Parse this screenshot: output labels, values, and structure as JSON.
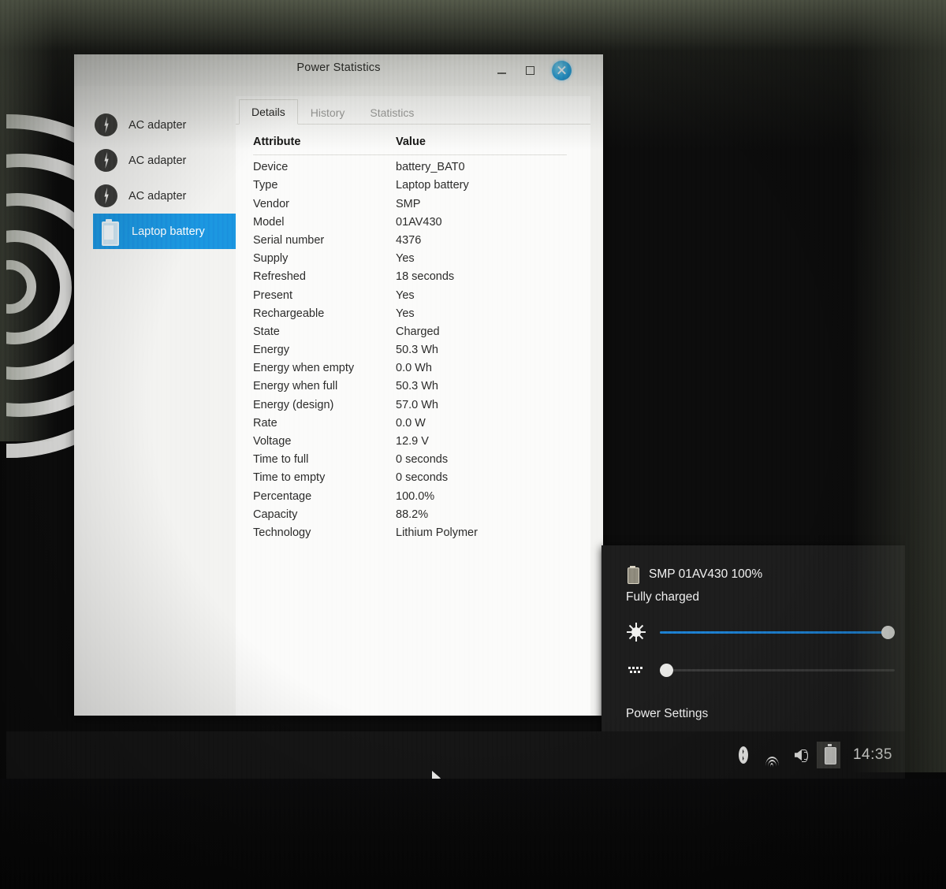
{
  "window": {
    "title": "Power Statistics",
    "controls": {
      "minimize": "minimize-button",
      "maximize": "maximize-button",
      "close": "close-button"
    }
  },
  "sidebar": {
    "devices": [
      {
        "label": "AC adapter",
        "icon": "ac-adapter-icon",
        "selected": false
      },
      {
        "label": "AC adapter",
        "icon": "ac-adapter-icon",
        "selected": false
      },
      {
        "label": "AC adapter",
        "icon": "ac-adapter-icon",
        "selected": false
      },
      {
        "label": "Laptop battery",
        "icon": "battery-icon",
        "selected": true
      }
    ]
  },
  "tabs": [
    {
      "label": "Details",
      "active": true
    },
    {
      "label": "History",
      "active": false
    },
    {
      "label": "Statistics",
      "active": false
    }
  ],
  "details": {
    "headers": {
      "attribute": "Attribute",
      "value": "Value"
    },
    "rows": [
      {
        "attribute": "Device",
        "value": "battery_BAT0"
      },
      {
        "attribute": "Type",
        "value": "Laptop battery"
      },
      {
        "attribute": "Vendor",
        "value": "SMP"
      },
      {
        "attribute": "Model",
        "value": "01AV430"
      },
      {
        "attribute": "Serial number",
        "value": "4376"
      },
      {
        "attribute": "Supply",
        "value": "Yes"
      },
      {
        "attribute": "Refreshed",
        "value": "18 seconds"
      },
      {
        "attribute": "Present",
        "value": "Yes"
      },
      {
        "attribute": "Rechargeable",
        "value": "Yes"
      },
      {
        "attribute": "State",
        "value": "Charged"
      },
      {
        "attribute": "Energy",
        "value": "50.3 Wh"
      },
      {
        "attribute": "Energy when empty",
        "value": "0.0 Wh"
      },
      {
        "attribute": "Energy when full",
        "value": "50.3 Wh"
      },
      {
        "attribute": "Energy (design)",
        "value": "57.0 Wh"
      },
      {
        "attribute": "Rate",
        "value": "0.0 W"
      },
      {
        "attribute": "Voltage",
        "value": "12.9 V"
      },
      {
        "attribute": "Time to full",
        "value": "0 seconds"
      },
      {
        "attribute": "Time to empty",
        "value": "0 seconds"
      },
      {
        "attribute": "Percentage",
        "value": "100.0%"
      },
      {
        "attribute": "Capacity",
        "value": "88.2%"
      },
      {
        "attribute": "Technology",
        "value": "Lithium Polymer"
      }
    ]
  },
  "power_popup": {
    "battery_title": "SMP 01AV430 100%",
    "battery_status": "Fully charged",
    "brightness": {
      "icon": "brightness-icon",
      "percent": 100
    },
    "keyboard_backlight": {
      "icon": "keyboard-backlight-icon",
      "percent": 0
    },
    "settings_link": "Power Settings"
  },
  "taskbar": {
    "tray": [
      {
        "icon": "bluetooth-icon",
        "highlighted": false
      },
      {
        "icon": "network-icon",
        "highlighted": false
      },
      {
        "icon": "volume-icon",
        "highlighted": false
      },
      {
        "icon": "battery-icon",
        "highlighted": true
      }
    ],
    "clock": "14:35"
  },
  "colors": {
    "accent": "#1b95e0",
    "slider_fill": "#1d7fd0",
    "window_bg": "#f3f3f1",
    "popup_bg": "#1d1d1d",
    "taskbar_bg": "#151515"
  }
}
